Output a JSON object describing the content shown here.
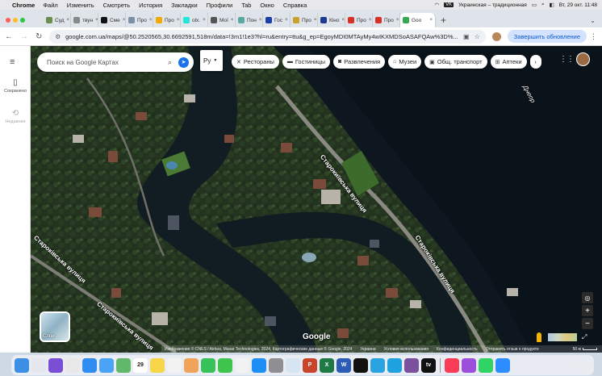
{
  "menubar": {
    "app": "Chrome",
    "items": [
      "Файл",
      "Изменить",
      "Смотреть",
      "История",
      "Закладки",
      "Профили",
      "Tab",
      "Окно",
      "Справка"
    ],
    "keyboard_badge": "VK",
    "keyboard_layout": "Украинская – традиционная",
    "datetime": "Вт, 29 окт. 11:48"
  },
  "tabs": [
    {
      "label": "Суд",
      "color": "#6b8e4e"
    },
    {
      "label": "твун",
      "color": "#888"
    },
    {
      "label": "Сме",
      "color": "#111"
    },
    {
      "label": "Про",
      "color": "#7a8fa8"
    },
    {
      "label": "Про",
      "color": "#f2a900"
    },
    {
      "label": "olx.",
      "color": "#23e5db"
    },
    {
      "label": "Мої",
      "color": "#555"
    },
    {
      "label": "Пон",
      "color": "#5aa9a0"
    },
    {
      "label": "Гос",
      "color": "#1a3fa8"
    },
    {
      "label": "Про",
      "color": "#c9a227"
    },
    {
      "label": "Кіно",
      "color": "#1d3b8f"
    },
    {
      "label": "Про",
      "color": "#d93025"
    },
    {
      "label": "Про",
      "color": "#d93025"
    },
    {
      "label": "Goo",
      "color": "#34a853",
      "active": true
    }
  ],
  "toolbar": {
    "url": "google.com.ua/maps/@50.2520565,30.6692591,518m/data=!3m1!1e3?hl=ru&entry=ttu&g_ep=EgoyMDI0MTAyMy4wIKXMDSoASAFQAw%3D%...",
    "update_label": "Завершить обновление"
  },
  "rail": {
    "saved_label": "Сохранено",
    "recent_label": "Недавние"
  },
  "search": {
    "placeholder": "Поиск на Google Картах"
  },
  "lang": {
    "value": "Ру"
  },
  "chips": [
    {
      "label": "Рестораны",
      "icon": "fork-knife-icon"
    },
    {
      "label": "Гостиницы",
      "icon": "bed-icon"
    },
    {
      "label": "Развлечения",
      "icon": "camera-icon"
    },
    {
      "label": "Музеи",
      "icon": "museum-icon"
    },
    {
      "label": "Общ. транспорт",
      "icon": "bus-icon"
    },
    {
      "label": "Аптеки",
      "icon": "pharmacy-icon"
    }
  ],
  "map": {
    "river_label": "Днепр",
    "street_labels": [
      "Старокиївська вулиця",
      "Староківська вулиця",
      "Староківська вулиця",
      "Старокиївська вулиця"
    ],
    "layers_label": "Слои",
    "logo": "Google",
    "attribution": "Изображения © CNES / Airbus, Maxar Technologies, 2024, Картографические данные © Google, 2024",
    "country": "Украина",
    "terms": "Условия использования",
    "privacy": "Конфиденциальность",
    "feedback": "Отправить отзыв о продукте",
    "scale": "50 м"
  },
  "dock": {
    "icons": [
      {
        "name": "finder",
        "color": "#3d8fe6"
      },
      {
        "name": "launchpad",
        "color": "#e6e6ee"
      },
      {
        "name": "siri",
        "color": "#7a4fd6"
      },
      {
        "name": "chrome",
        "color": "#e8e8e8"
      },
      {
        "name": "safari",
        "color": "#2f8cf0"
      },
      {
        "name": "mail",
        "color": "#4aa3f5"
      },
      {
        "name": "maps",
        "color": "#62b86a"
      },
      {
        "name": "calendar",
        "color": "#ffffff",
        "text": "29"
      },
      {
        "name": "notes",
        "color": "#f7d64a"
      },
      {
        "name": "reminders",
        "color": "#f2f2f2"
      },
      {
        "name": "photos",
        "color": "#f0a45b"
      },
      {
        "name": "facetime",
        "color": "#38c25a"
      },
      {
        "name": "messages",
        "color": "#40c54c"
      },
      {
        "name": "music",
        "color": "#f2f2f2"
      },
      {
        "name": "appstore",
        "color": "#1c8ef5"
      },
      {
        "name": "settings",
        "color": "#8e8e93"
      },
      {
        "name": "preview",
        "color": "#d7e4f2"
      },
      {
        "name": "powerpoint",
        "color": "#c8452c",
        "text": "P"
      },
      {
        "name": "excel",
        "color": "#1f7a45",
        "text": "X"
      },
      {
        "name": "word",
        "color": "#2b5cb8",
        "text": "W"
      },
      {
        "name": "capcut",
        "color": "#111111"
      },
      {
        "name": "telegram",
        "color": "#2aa4e0"
      },
      {
        "name": "skype",
        "color": "#1fa3e0"
      },
      {
        "name": "viber",
        "color": "#7b519d"
      },
      {
        "name": "appletv",
        "color": "#111111",
        "text": "tv"
      },
      {
        "name": "musicapp",
        "color": "#fa3c56"
      },
      {
        "name": "podcasts",
        "color": "#9b4fdb"
      },
      {
        "name": "whatsapp",
        "color": "#2fd465"
      },
      {
        "name": "zoom",
        "color": "#2d8cff"
      }
    ]
  }
}
